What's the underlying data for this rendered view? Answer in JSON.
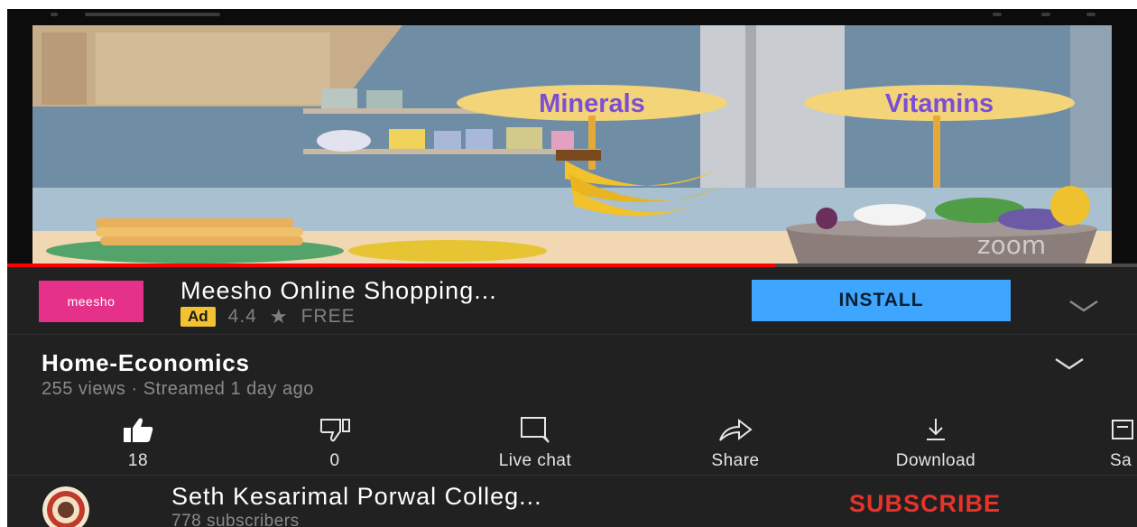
{
  "video": {
    "labels": [
      "Minerals",
      "Vitamins"
    ],
    "watermark": "zoom",
    "progress": 0.68
  },
  "ad": {
    "logo_text": "meesho",
    "title": "Meesho Online Shopping...",
    "badge": "Ad",
    "rating": "4.4",
    "rating_icon": "star-icon",
    "price": "FREE",
    "install_label": "INSTALL",
    "colors": {
      "logo_bg": "#e6318a",
      "install_bg": "#3ea6ff",
      "badge_bg": "#f2c232"
    }
  },
  "details": {
    "title": "Home-Economics",
    "meta": "255 views · Streamed 1 day ago"
  },
  "actions": [
    {
      "icon": "like-icon",
      "label": "18"
    },
    {
      "icon": "dislike-icon",
      "label": "0"
    },
    {
      "icon": "live-chat-icon",
      "label": "Live chat"
    },
    {
      "icon": "share-icon",
      "label": "Share"
    },
    {
      "icon": "download-icon",
      "label": "Download"
    },
    {
      "icon": "save-icon",
      "label": "Sa"
    }
  ],
  "channel": {
    "name": "Seth Kesarimal Porwal Colleg...",
    "subscribers": "778 subscribers",
    "subscribe_label": "SUBSCRIBE",
    "subscribe_color": "#e8332a"
  }
}
